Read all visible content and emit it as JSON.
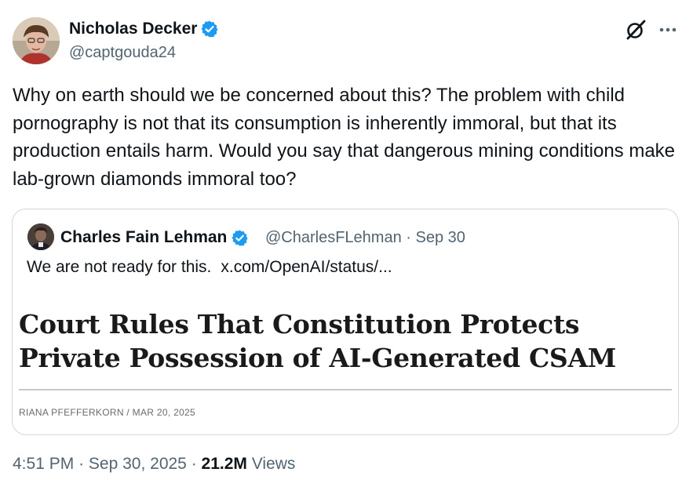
{
  "author": {
    "name": "Nicholas Decker",
    "handle": "@captgouda24"
  },
  "tweet": {
    "text": "Why on earth should we be concerned about this? The problem with child pornography is not that its consumption is inherently immoral, but that its production entails harm. Would you say that dangerous mining conditions make lab-grown diamonds immoral too?"
  },
  "quote": {
    "name": "Charles Fain Lehman",
    "handle": "@CharlesFLehman",
    "separator": "·",
    "date": "Sep 30",
    "text": "We are not ready for this.",
    "link": "x.com/OpenAI/status/...",
    "article": {
      "headline_line1": "Court Rules That Constitution Protects",
      "headline_line2": "Private Possession of AI-Generated CSAM",
      "byline": "RIANA PFEFFERKORN / MAR 20, 2025"
    }
  },
  "meta": {
    "time": "4:51 PM",
    "sep1": "·",
    "date": "Sep 30, 2025",
    "sep2": "·",
    "views_count": "21.2M",
    "views_label": "Views"
  },
  "colors": {
    "verified": "#1d9bf0",
    "secondary_text": "#536471",
    "primary_text": "#0f1419",
    "border": "#cfd9de"
  },
  "icons": {
    "verified": "verified-badge-icon",
    "grok": "grok-icon",
    "more": "more-options-icon"
  }
}
